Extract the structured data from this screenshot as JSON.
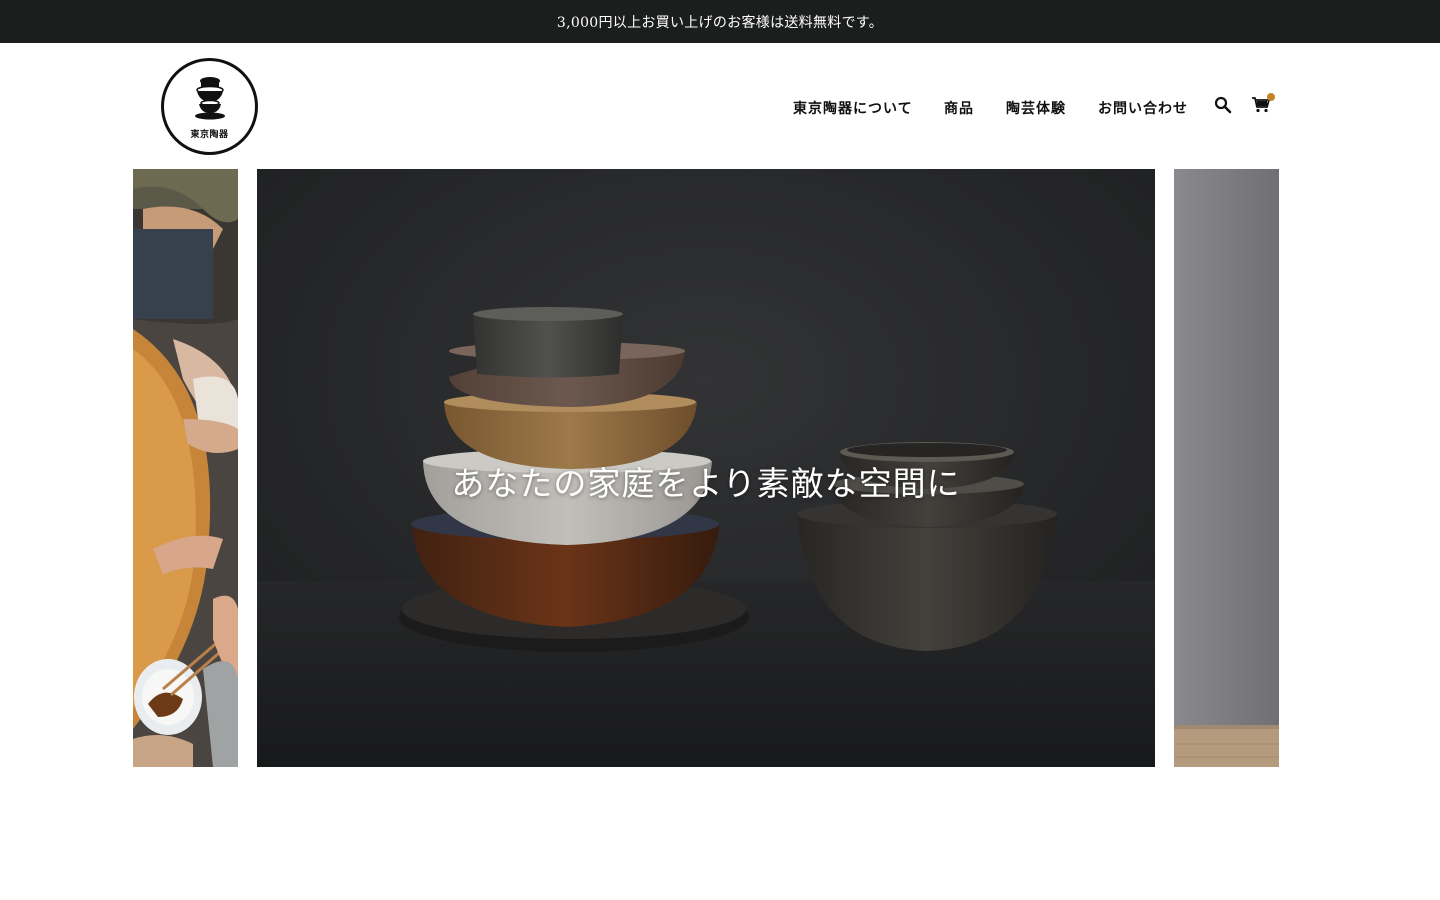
{
  "announcement": "3,000円以上お買い上げのお客様は送料無料です。",
  "logo": {
    "text": "東京陶器"
  },
  "nav": {
    "items": [
      {
        "label": "東京陶器について"
      },
      {
        "label": "商品"
      },
      {
        "label": "陶芸体験"
      },
      {
        "label": "お問い合わせ"
      }
    ],
    "search_icon": "search-icon",
    "cart_icon": "cart-icon"
  },
  "hero": {
    "headline": "あなたの家庭をより素敵な空間に"
  },
  "colors": {
    "announcement_bg": "#1c1e1e",
    "cart_badge": "#c4822a",
    "hero_bg": "#27282a"
  }
}
